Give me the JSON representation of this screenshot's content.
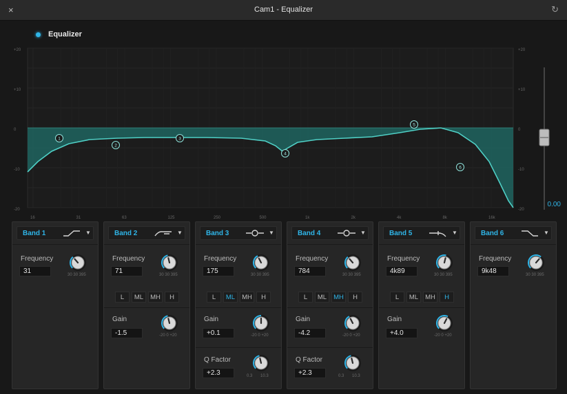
{
  "window": {
    "title": "Cam1 - Equalizer",
    "close_glyph": "×",
    "reset_glyph": "↻"
  },
  "equalizer_toggle": {
    "label": "Equalizer",
    "enabled": true
  },
  "graph": {
    "y_labels_left": [
      "+20",
      "+10",
      "0",
      "-10",
      "-20"
    ],
    "y_labels_right": [
      "+20",
      "+10",
      "0",
      "-10",
      "-20"
    ],
    "x_labels": [
      "16",
      "31",
      "63",
      "125",
      "250",
      "500",
      "1k",
      "2k",
      "4k",
      "8k",
      "16k"
    ],
    "markers": [
      "1",
      "2",
      "3",
      "4",
      "5",
      "6"
    ],
    "curve_color": "#4fd0c6",
    "fill_color": "#1f6e68"
  },
  "output": {
    "level": 0.0,
    "label": "0.00"
  },
  "bands": [
    {
      "name": "Band 1",
      "shape_icon": "low-shelf-icon",
      "frequency_label": "Frequency",
      "frequency": "31",
      "freq_knob": 0.35,
      "freq_scale": [
        "30",
        "30",
        "395"
      ]
    },
    {
      "name": "Band 2",
      "shape_icon": "low-cut-icon",
      "frequency_label": "Frequency",
      "frequency": "71",
      "freq_knob": 0.45,
      "freq_scale": [
        "30",
        "30",
        "395"
      ],
      "ranges": [
        "L",
        "ML",
        "MH",
        "H"
      ],
      "range_active": "",
      "gain_label": "Gain",
      "gain": "-1.5",
      "gain_knob": 0.45,
      "gain_scale": [
        "-20",
        "0",
        "+20"
      ]
    },
    {
      "name": "Band 3",
      "shape_icon": "bell-icon",
      "frequency_label": "Frequency",
      "frequency": "175",
      "freq_knob": 0.4,
      "freq_scale": [
        "30",
        "30",
        "395"
      ],
      "ranges": [
        "L",
        "ML",
        "MH",
        "H"
      ],
      "range_active": "ML",
      "gain_label": "Gain",
      "gain": "+0.1",
      "gain_knob": 0.5,
      "gain_scale": [
        "-20",
        "0",
        "+20"
      ],
      "q_label": "Q Factor",
      "q": "+2.3",
      "q_knob": 0.45,
      "q_scale": [
        "0.3",
        "10.3"
      ]
    },
    {
      "name": "Band 4",
      "shape_icon": "bell-icon",
      "frequency_label": "Frequency",
      "frequency": "784",
      "freq_knob": 0.35,
      "freq_scale": [
        "30",
        "30",
        "395"
      ],
      "ranges": [
        "L",
        "ML",
        "MH",
        "H"
      ],
      "range_active": "MH",
      "gain_label": "Gain",
      "gain": "-4.2",
      "gain_knob": 0.4,
      "gain_scale": [
        "-20",
        "0",
        "+20"
      ],
      "q_label": "Q Factor",
      "q": "+2.3",
      "q_knob": 0.45,
      "q_scale": [
        "0.3",
        "10.3"
      ]
    },
    {
      "name": "Band 5",
      "shape_icon": "high-cut-icon",
      "frequency_label": "Frequency",
      "frequency": "4k89",
      "freq_knob": 0.55,
      "freq_scale": [
        "30",
        "30",
        "395"
      ],
      "ranges": [
        "L",
        "ML",
        "MH",
        "H"
      ],
      "range_active": "H",
      "gain_label": "Gain",
      "gain": "+4.0",
      "gain_knob": 0.6,
      "gain_scale": [
        "-20",
        "0",
        "+20"
      ]
    },
    {
      "name": "Band 6",
      "shape_icon": "high-shelf-icon",
      "frequency_label": "Frequency",
      "frequency": "9k48",
      "freq_knob": 0.65,
      "freq_scale": [
        "30",
        "30",
        "395"
      ]
    }
  ]
}
